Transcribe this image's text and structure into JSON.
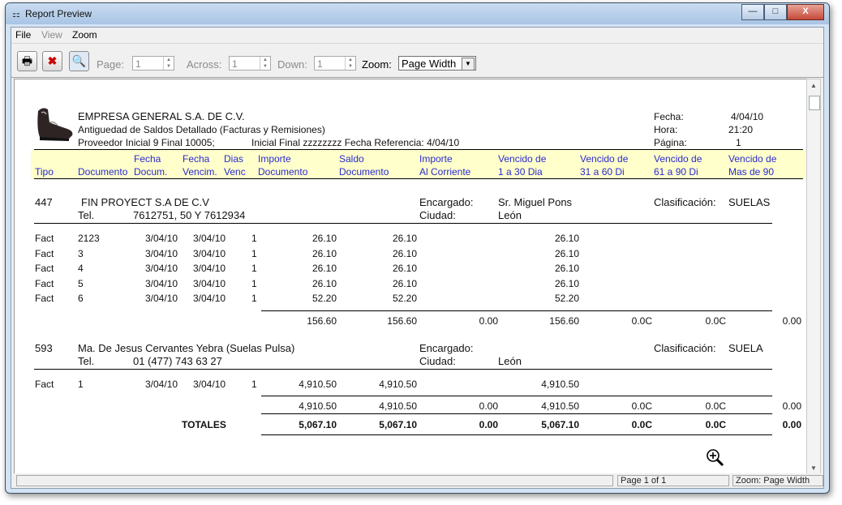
{
  "window": {
    "title": "Report Preview",
    "min": "—",
    "max": "□",
    "close": "X"
  },
  "menu": {
    "file": "File",
    "view": "View",
    "zoom": "Zoom"
  },
  "toolbar": {
    "page_label": "Page:",
    "page_value": "1",
    "across_label": "Across:",
    "across_value": "1",
    "down_label": "Down:",
    "down_value": "1",
    "zoom_label": "Zoom:",
    "zoom_value": "Page Width"
  },
  "report": {
    "company": "EMPRESA GENERAL S.A. DE C.V.",
    "subtitle": "Antiguedad de Saldos Detallado (Facturas y Remisiones)",
    "filters": "Proveedor Inicial 9 Final 10005;",
    "filters2": "Inicial  Final zzzzzzzz   Fecha Referencia:  4/04/10",
    "fecha_label": "Fecha:",
    "fecha_value": "4/04/10",
    "hora_label": "Hora:",
    "hora_value": "21:20",
    "pagina_label": "Página:",
    "pagina_value": "1",
    "columns": [
      {
        "l1": "",
        "l2": "Tipo"
      },
      {
        "l1": "",
        "l2": "Documento"
      },
      {
        "l1": "Fecha",
        "l2": "Docum."
      },
      {
        "l1": "Fecha",
        "l2": "Vencim."
      },
      {
        "l1": "Dias",
        "l2": "Venc"
      },
      {
        "l1": "Importe",
        "l2": "Documento"
      },
      {
        "l1": "Saldo",
        "l2": "Documento"
      },
      {
        "l1": "Importe",
        "l2": "Al Corriente"
      },
      {
        "l1": "Vencido de",
        "l2": "1 a 30 Dia"
      },
      {
        "l1": "Vencido de",
        "l2": "31 a 60 Di"
      },
      {
        "l1": "Vencido de",
        "l2": "61 a 90 Di"
      },
      {
        "l1": "Vencido de",
        "l2": "Mas de 90"
      }
    ],
    "groups": [
      {
        "code": "447",
        "name": "FIN PROYECT S.A DE C.V",
        "tel_label": "Tel.",
        "tel": "7612751, 50 Y 7612934",
        "encargado_label": "Encargado:",
        "encargado": "Sr. Miguel Pons",
        "ciudad_label": "Ciudad:",
        "ciudad": "León",
        "clas_label": "Clasificación:",
        "clas": "SUELAS",
        "rows": [
          {
            "tipo": "Fact",
            "doc": "2123",
            "fdoc": "3/04/10",
            "fven": "3/04/10",
            "dias": "1",
            "imp": "26.10",
            "saldo": "26.10",
            "v1": "26.10"
          },
          {
            "tipo": "Fact",
            "doc": "3",
            "fdoc": "3/04/10",
            "fven": "3/04/10",
            "dias": "1",
            "imp": "26.10",
            "saldo": "26.10",
            "v1": "26.10"
          },
          {
            "tipo": "Fact",
            "doc": "4",
            "fdoc": "3/04/10",
            "fven": "3/04/10",
            "dias": "1",
            "imp": "26.10",
            "saldo": "26.10",
            "v1": "26.10"
          },
          {
            "tipo": "Fact",
            "doc": "5",
            "fdoc": "3/04/10",
            "fven": "3/04/10",
            "dias": "1",
            "imp": "26.10",
            "saldo": "26.10",
            "v1": "26.10"
          },
          {
            "tipo": "Fact",
            "doc": "6",
            "fdoc": "3/04/10",
            "fven": "3/04/10",
            "dias": "1",
            "imp": "52.20",
            "saldo": "52.20",
            "v1": "52.20"
          }
        ],
        "subtotal": {
          "imp": "156.60",
          "saldo": "156.60",
          "corr": "0.00",
          "v1": "156.60",
          "v2": "0.0C",
          "v3": "0.0C",
          "v4": "0.00"
        }
      },
      {
        "code": "593",
        "name": "Ma. De Jesus Cervantes Yebra (Suelas Pulsa)",
        "tel_label": "Tel.",
        "tel": "01 (477) 743 63 27",
        "encargado_label": "Encargado:",
        "encargado": "",
        "ciudad_label": "Ciudad:",
        "ciudad": "León",
        "clas_label": "Clasificación:",
        "clas": "SUELA",
        "rows": [
          {
            "tipo": "Fact",
            "doc": "1",
            "fdoc": "3/04/10",
            "fven": "3/04/10",
            "dias": "1",
            "imp": "4,910.50",
            "saldo": "4,910.50",
            "v1": "4,910.50"
          }
        ],
        "subtotal": {
          "imp": "4,910.50",
          "saldo": "4,910.50",
          "corr": "0.00",
          "v1": "4,910.50",
          "v2": "0.0C",
          "v3": "0.0C",
          "v4": "0.00"
        }
      }
    ],
    "totals": {
      "label": "TOTALES",
      "imp": "5,067.10",
      "saldo": "5,067.10",
      "corr": "0.00",
      "v1": "5,067.10",
      "v2": "0.0C",
      "v3": "0.0C",
      "v4": "0.00"
    }
  },
  "status": {
    "page": "Page 1 of 1",
    "zoom": "Zoom: Page Width"
  }
}
